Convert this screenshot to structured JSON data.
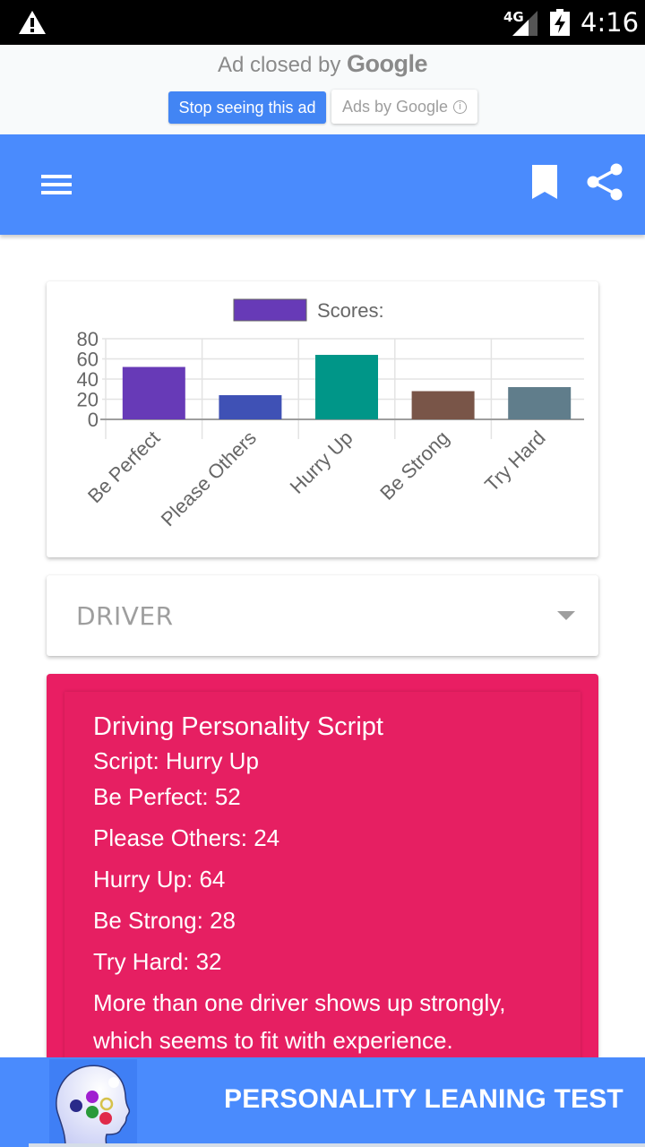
{
  "status_bar": {
    "network": "4G",
    "time": "4:16"
  },
  "ad": {
    "closed_text": "Ad closed by",
    "brand": "Google",
    "stop_button": "Stop seeing this ad",
    "ads_by_button": "Ads by Google",
    "info_glyph": "i"
  },
  "app_bar": {
    "icons": [
      "menu-icon",
      "bookmark-icon",
      "share-icon"
    ]
  },
  "chart_data": {
    "type": "bar",
    "legend": "Scores:",
    "legend_placement": "top-center",
    "categories": [
      "Be Perfect",
      "Please Others",
      "Hurry Up",
      "Be Strong",
      "Try Hard"
    ],
    "values": [
      52,
      24,
      64,
      28,
      32
    ],
    "colors": [
      "#673ab7",
      "#3f51b5",
      "#009688",
      "#795548",
      "#607d8b"
    ],
    "yticks": [
      0,
      20,
      40,
      60,
      80
    ],
    "ylim": [
      0,
      80
    ],
    "grid": true,
    "xlabel": "",
    "ylabel": "",
    "title": ""
  },
  "dropdown": {
    "selected": "DRIVER"
  },
  "result": {
    "title": "Driving Personality Script",
    "script_line": "Script: Hurry Up",
    "scores": [
      "Be Perfect: 52",
      "Please Others: 24",
      "Hurry Up: 64",
      "Be Strong: 28",
      "Try Hard: 32"
    ],
    "summary": "More than one driver shows up strongly, which seems to fit with experience."
  },
  "footer": {
    "app_name": "PERSONALITY LEANING TEST"
  },
  "colors": {
    "primary": "#4a8bfd",
    "accent": "#e91e63",
    "ad_button": "#4285f4"
  }
}
